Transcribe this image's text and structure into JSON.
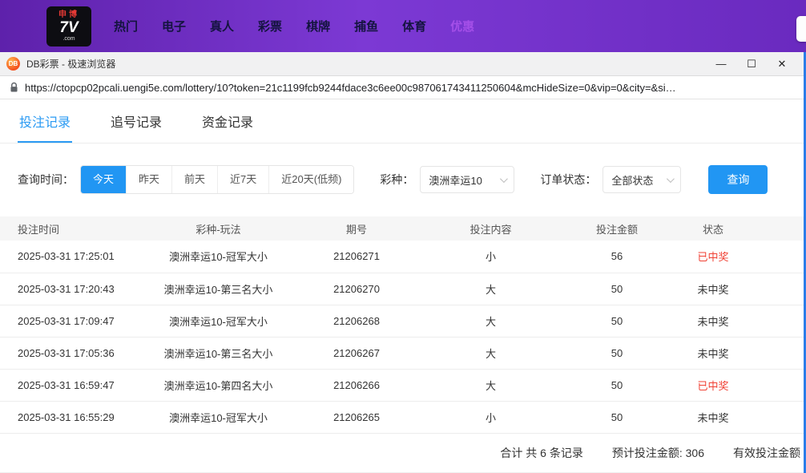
{
  "colors": {
    "accent": "#2196f3",
    "win_red": "#f04134",
    "nav_purple": "#a44fe8"
  },
  "top_nav": {
    "logo": {
      "line1": "申博",
      "line2": "7V",
      "line3": ".com"
    },
    "items": [
      {
        "label": "热门"
      },
      {
        "label": "电子"
      },
      {
        "label": "真人"
      },
      {
        "label": "彩票"
      },
      {
        "label": "棋牌"
      },
      {
        "label": "捕鱼"
      },
      {
        "label": "体育"
      },
      {
        "label": "优惠"
      }
    ]
  },
  "browser": {
    "favicon_text": "DB",
    "title": "DB彩票 - 极速浏览器",
    "controls": {
      "minimize": "—",
      "maximize": "☐",
      "close": "✕"
    },
    "url": "https://ctopcp02pcali.uengi5e.com/lottery/10?token=21c1199fcb9244fdace3c6ee00c987061743411250604&mcHideSize=0&vip=0&city=&si…"
  },
  "tabs": [
    {
      "label": "投注记录"
    },
    {
      "label": "追号记录"
    },
    {
      "label": "资金记录"
    }
  ],
  "filters": {
    "time_label": "查询时间：",
    "time_options": [
      "今天",
      "昨天",
      "前天",
      "近7天",
      "近20天(低频)"
    ],
    "active_time": "今天",
    "lottery_label": "彩种：",
    "lottery_value": "澳洲幸运10",
    "status_label": "订单状态：",
    "status_value": "全部状态",
    "query_button": "查询"
  },
  "table": {
    "headers": [
      "投注时间",
      "彩种-玩法",
      "期号",
      "投注内容",
      "投注金额",
      "状态"
    ],
    "rows": [
      {
        "time": "2025-03-31 17:25:01",
        "game": "澳洲幸运10-冠军大小",
        "issue": "21206271",
        "content": "小",
        "amount": 56,
        "status": "已中奖",
        "won": true
      },
      {
        "time": "2025-03-31 17:20:43",
        "game": "澳洲幸运10-第三名大小",
        "issue": "21206270",
        "content": "大",
        "amount": 50,
        "status": "未中奖",
        "won": false
      },
      {
        "time": "2025-03-31 17:09:47",
        "game": "澳洲幸运10-冠军大小",
        "issue": "21206268",
        "content": "大",
        "amount": 50,
        "status": "未中奖",
        "won": false
      },
      {
        "time": "2025-03-31 17:05:36",
        "game": "澳洲幸运10-第三名大小",
        "issue": "21206267",
        "content": "大",
        "amount": 50,
        "status": "未中奖",
        "won": false
      },
      {
        "time": "2025-03-31 16:59:47",
        "game": "澳洲幸运10-第四名大小",
        "issue": "21206266",
        "content": "大",
        "amount": 50,
        "status": "已中奖",
        "won": true
      },
      {
        "time": "2025-03-31 16:55:29",
        "game": "澳洲幸运10-冠军大小",
        "issue": "21206265",
        "content": "小",
        "amount": 50,
        "status": "未中奖",
        "won": false
      }
    ]
  },
  "summary": {
    "total": "合计 共 6 条记录",
    "expected": "预计投注金额: 306",
    "valid": "有效投注金额"
  }
}
